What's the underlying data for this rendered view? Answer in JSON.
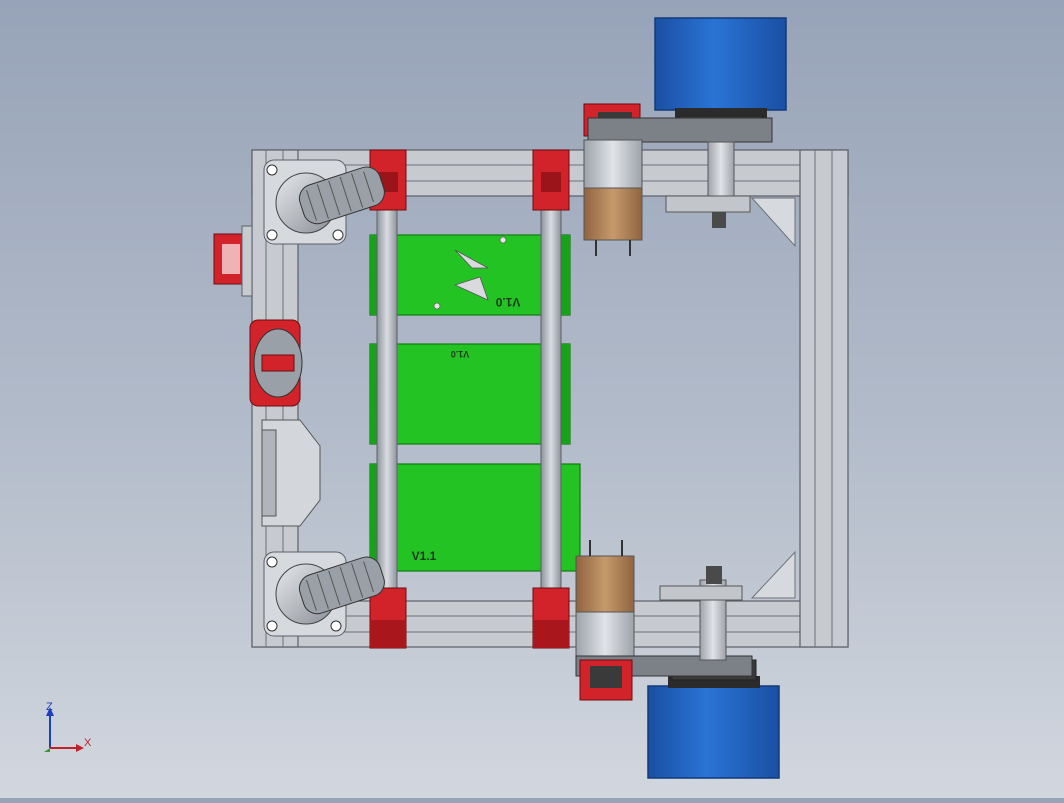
{
  "model": {
    "board_labels": {
      "top": "V1.0",
      "middle": "V1.0",
      "bottom": "V1.1"
    }
  },
  "triad": {
    "z_label": "Z",
    "x_label": "X"
  },
  "colors": {
    "background_top": "#97a3b8",
    "background_bottom": "#d2d7df",
    "aluminum": "#c9ccd1",
    "bracket_red": "#d2232a",
    "board_green": "#22c322",
    "wheel_blue": "#1e63c5",
    "motor_copper": "#b98a5f"
  }
}
